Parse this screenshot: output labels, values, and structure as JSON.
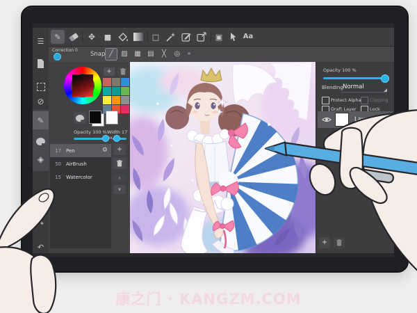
{
  "icons": {
    "hamburger": "☰",
    "pen": "✎",
    "filled_square": "■",
    "rect_outline": "□",
    "circle_slash": "⊘",
    "move": "✥",
    "panels": "▣",
    "layers": "◈",
    "text_tool": "Aa",
    "snap_diagonal": "╱",
    "snap_hatch": "▨",
    "snap_grid": "▦",
    "snap_hlines": "▤",
    "snap_cross": "╳",
    "snap_radial": "◎",
    "snap_more": "·",
    "plus": "+",
    "gear": "⚙",
    "undo": "↶",
    "redo": "↷",
    "chevron_up": "∧",
    "chevron_down": "∨"
  },
  "correction": {
    "label": "Correction 0"
  },
  "snap": {
    "label": "Snap"
  },
  "brush_panel": {
    "opacity_label": "Opacity 100 %",
    "width_label": "Width 17 px",
    "palette": [
      "#c9645c",
      "#7e786d",
      "#2f8fdc",
      "#12a7a3",
      "#0d9b91",
      "#6db54e",
      "#f6ed3d",
      "#f29b00",
      "#909090",
      "#5d7e95",
      "#e8542f",
      "#e62e63"
    ],
    "brushes": [
      {
        "size": "17",
        "name": "Pen"
      },
      {
        "size": "50",
        "name": "AirBrush"
      },
      {
        "size": "15",
        "name": "Watercolor"
      }
    ]
  },
  "layer_panel": {
    "opacity_label": "Opacity 100 %",
    "blending_label": "Blending",
    "blending_value": "Normal",
    "checkbox_protect_alpha": "Protect Alpha",
    "checkbox_clipping": "Clipping",
    "checkbox_draft": "Draft Layer",
    "checkbox_lock": "Lock",
    "layer_name": "Layer"
  },
  "watermark": "康之门 · KANGZM.COM",
  "colors": {
    "accent": "#2bb3e6",
    "stylus": "#58ade2",
    "canvas_bg": "#2c2c2e"
  }
}
